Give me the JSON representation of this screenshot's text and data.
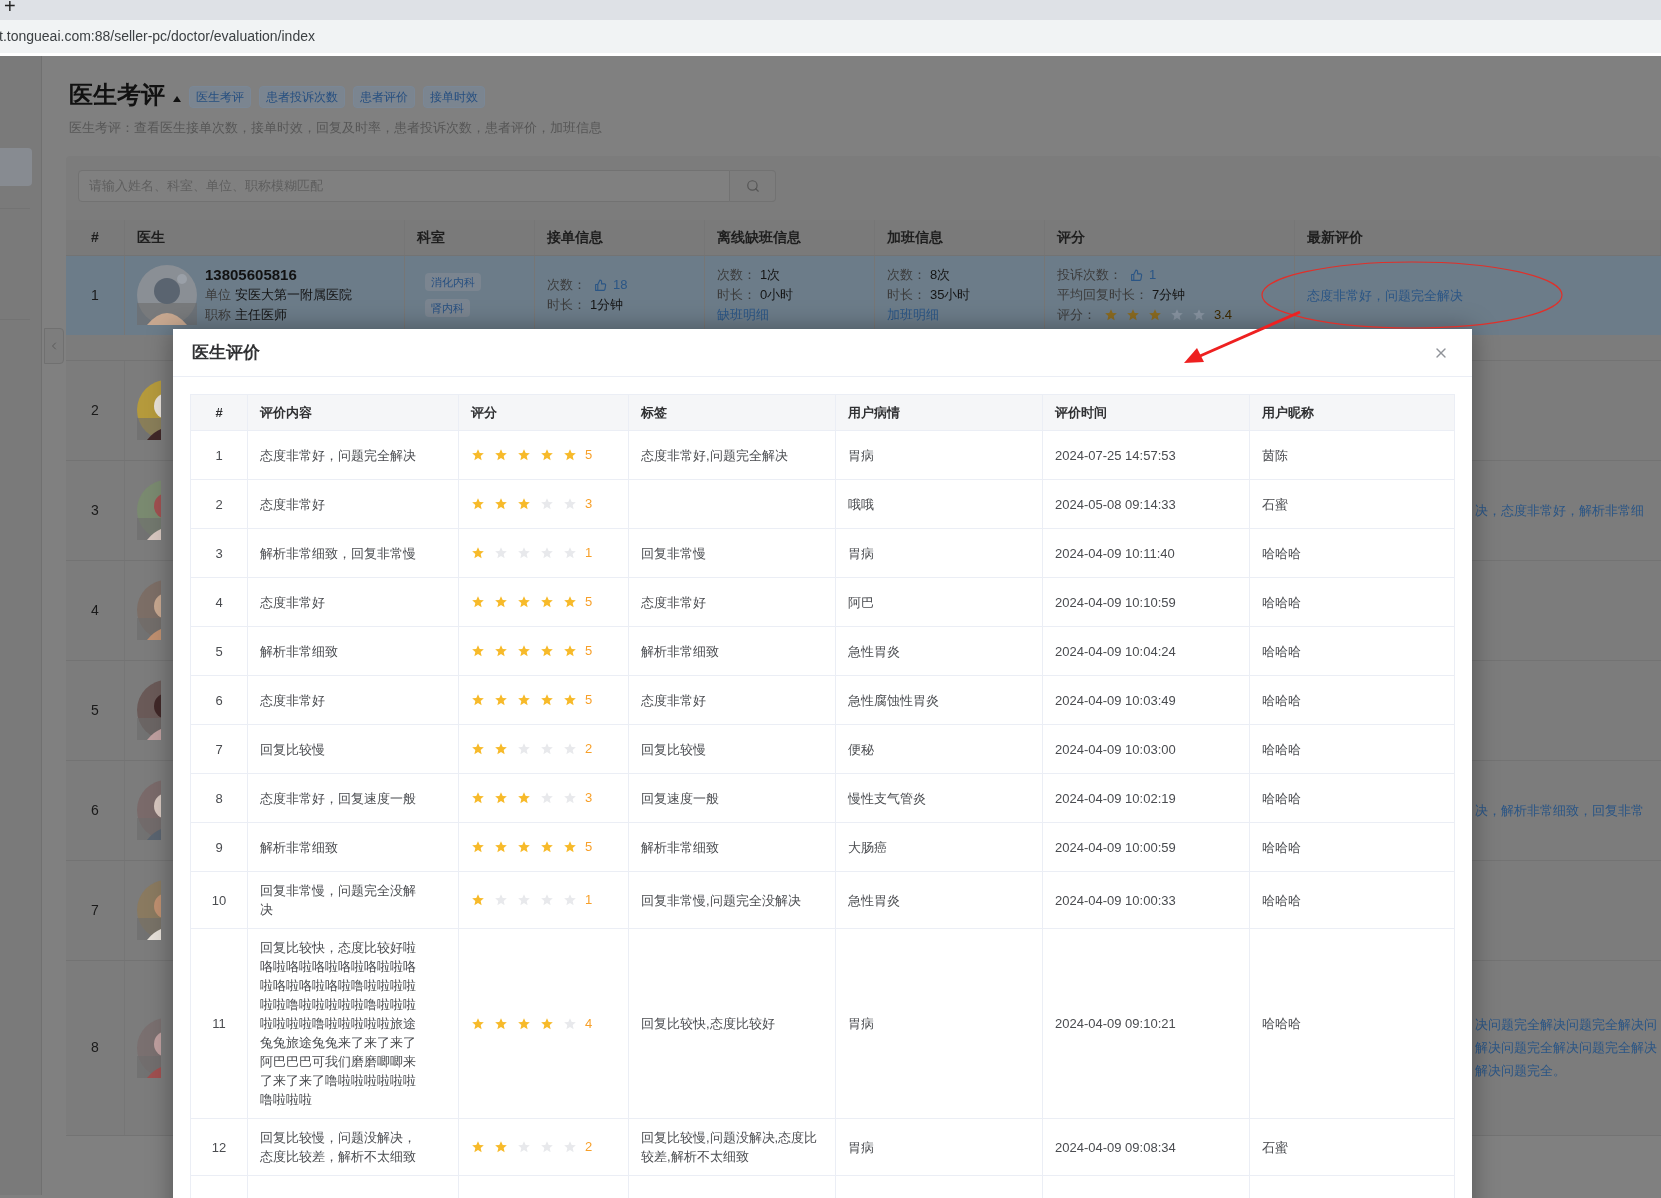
{
  "browser": {
    "new_tab": "+",
    "url": "t.tongueai.com:88/seller-pc/doctor/evaluation/index"
  },
  "page": {
    "title": "医生考评",
    "tags": [
      "医生考评",
      "患者投诉次数",
      "患者评价",
      "接单时效"
    ],
    "description": "医生考评：查看医生接单次数，接单时效，回复及时率，患者投诉次数，患者评价，加班信息"
  },
  "search": {
    "placeholder": "请输入姓名、科室、单位、职称模糊匹配"
  },
  "doctor_table": {
    "columns": [
      "#",
      "医生",
      "科室",
      "接单信息",
      "离线缺班信息",
      "加班信息",
      "评分",
      "最新评价"
    ],
    "rows": [
      {
        "index": "1",
        "selected": true,
        "phone": "13805605816",
        "unit_label": "单位",
        "unit": "安医大第一附属医院",
        "title_label": "职称",
        "title": "主任医师",
        "departments": [
          "消化内科",
          "肾内科"
        ],
        "orders": {
          "count_label": "次数：",
          "count": "18",
          "duration_label": "时长：",
          "duration": "1分钟"
        },
        "absence": {
          "count_label": "次数：",
          "count": "1次",
          "duration_label": "时长：",
          "duration": "0小时",
          "link": "缺班明细"
        },
        "overtime": {
          "count_label": "次数：",
          "count": "8次",
          "duration_label": "时长：",
          "duration": "35小时",
          "link": "加班明细"
        },
        "rating": {
          "complaints_label": "投诉次数：",
          "complaints": "1",
          "reply_label": "平均回复时长：",
          "reply": "7分钟",
          "score_label": "评分：",
          "stars": 3,
          "score": "3.4"
        },
        "latest": [
          "态度非常好，问题完全解决"
        ]
      },
      {
        "index": "2",
        "selected": false
      },
      {
        "index": "3",
        "selected": false,
        "latest": [
          "决，态度非常好，解析非常细"
        ]
      },
      {
        "index": "4",
        "selected": false
      },
      {
        "index": "5",
        "selected": false
      },
      {
        "index": "6",
        "selected": false,
        "latest": [
          "决，解析非常细致，回复非常"
        ]
      },
      {
        "index": "7",
        "selected": false
      },
      {
        "index": "8",
        "selected": false,
        "latest": [
          "决问题完全解决问题完全解决问",
          "解决问题完全解决问题完全解决",
          "解决问题完全。"
        ]
      }
    ]
  },
  "dialog": {
    "title": "医生评价",
    "columns": [
      "#",
      "评价内容",
      "评分",
      "标签",
      "用户病情",
      "评价时间",
      "用户昵称"
    ],
    "rows": [
      {
        "index": "1",
        "content": "态度非常好，问题完全解决",
        "stars": 5,
        "score": "5",
        "tags": "态度非常好,问题完全解决",
        "condition": "胃病",
        "time": "2024-07-25 14:57:53",
        "nickname": "茵陈"
      },
      {
        "index": "2",
        "content": "态度非常好",
        "stars": 3,
        "score": "3",
        "condition": "哦哦",
        "time": "2024-05-08 09:14:33",
        "nickname": "石蜜"
      },
      {
        "index": "3",
        "content": "解析非常细致，回复非常慢",
        "stars": 1,
        "score": "1",
        "tags": "回复非常慢",
        "condition": "胃病",
        "time": "2024-04-09 10:11:40",
        "nickname": "哈哈哈"
      },
      {
        "index": "4",
        "content": "态度非常好",
        "stars": 5,
        "score": "5",
        "tags": "态度非常好",
        "condition": "阿巴",
        "time": "2024-04-09 10:10:59",
        "nickname": "哈哈哈"
      },
      {
        "index": "5",
        "content": "解析非常细致",
        "stars": 5,
        "score": "5",
        "tags": "解析非常细致",
        "condition": "急性胃炎",
        "time": "2024-04-09 10:04:24",
        "nickname": "哈哈哈"
      },
      {
        "index": "6",
        "content": "态度非常好",
        "stars": 5,
        "score": "5",
        "tags": "态度非常好",
        "condition": "急性腐蚀性胃炎",
        "time": "2024-04-09 10:03:49",
        "nickname": "哈哈哈"
      },
      {
        "index": "7",
        "content": "回复比较慢",
        "stars": 2,
        "score": "2",
        "tags": "回复比较慢",
        "condition": "便秘",
        "time": "2024-04-09 10:03:00",
        "nickname": "哈哈哈"
      },
      {
        "index": "8",
        "content": "态度非常好，回复速度一般",
        "stars": 3,
        "score": "3",
        "tags": "回复速度一般",
        "condition": "慢性支气管炎",
        "time": "2024-04-09 10:02:19",
        "nickname": "哈哈哈"
      },
      {
        "index": "9",
        "content": "解析非常细致",
        "stars": 5,
        "score": "5",
        "tags": "解析非常细致",
        "condition": "大肠癌",
        "time": "2024-04-09 10:00:59",
        "nickname": "哈哈哈"
      },
      {
        "index": "10",
        "content": "回复非常慢，问题完全没解决",
        "stars": 1,
        "score": "1",
        "tags": "回复非常慢,问题完全没解决",
        "condition": "急性胃炎",
        "time": "2024-04-09 10:00:33",
        "nickname": "哈哈哈"
      },
      {
        "index": "11",
        "content": "回复比较快，态度比较好啦咯啦咯啦咯啦咯啦咯啦啦咯啦咯啦咯啦咯啦噜啦啦啦啦啦啦噜啦啦啦啦啦噜啦啦啦啦啦啦啦噜啦啦啦啦啦旅途兔兔旅途兔兔来了来了来了阿巴巴巴可我们磨磨唧唧来了来了来了噜啦啦啦啦啦啦噜啦啦啦",
        "stars": 4,
        "score": "4",
        "tags": "回复比较快,态度比较好",
        "condition": "胃病",
        "time": "2024-04-09 09:10:21",
        "nickname": "哈哈哈"
      },
      {
        "index": "12",
        "content": "回复比较慢，问题没解决，态度比较差，解析不太细致",
        "stars": 2,
        "score": "2",
        "tags": "回复比较慢,问题没解决,态度比较差,解析不太细致",
        "condition": "胃病",
        "time": "2024-04-09 09:08:34",
        "nickname": "石蜜"
      }
    ]
  }
}
